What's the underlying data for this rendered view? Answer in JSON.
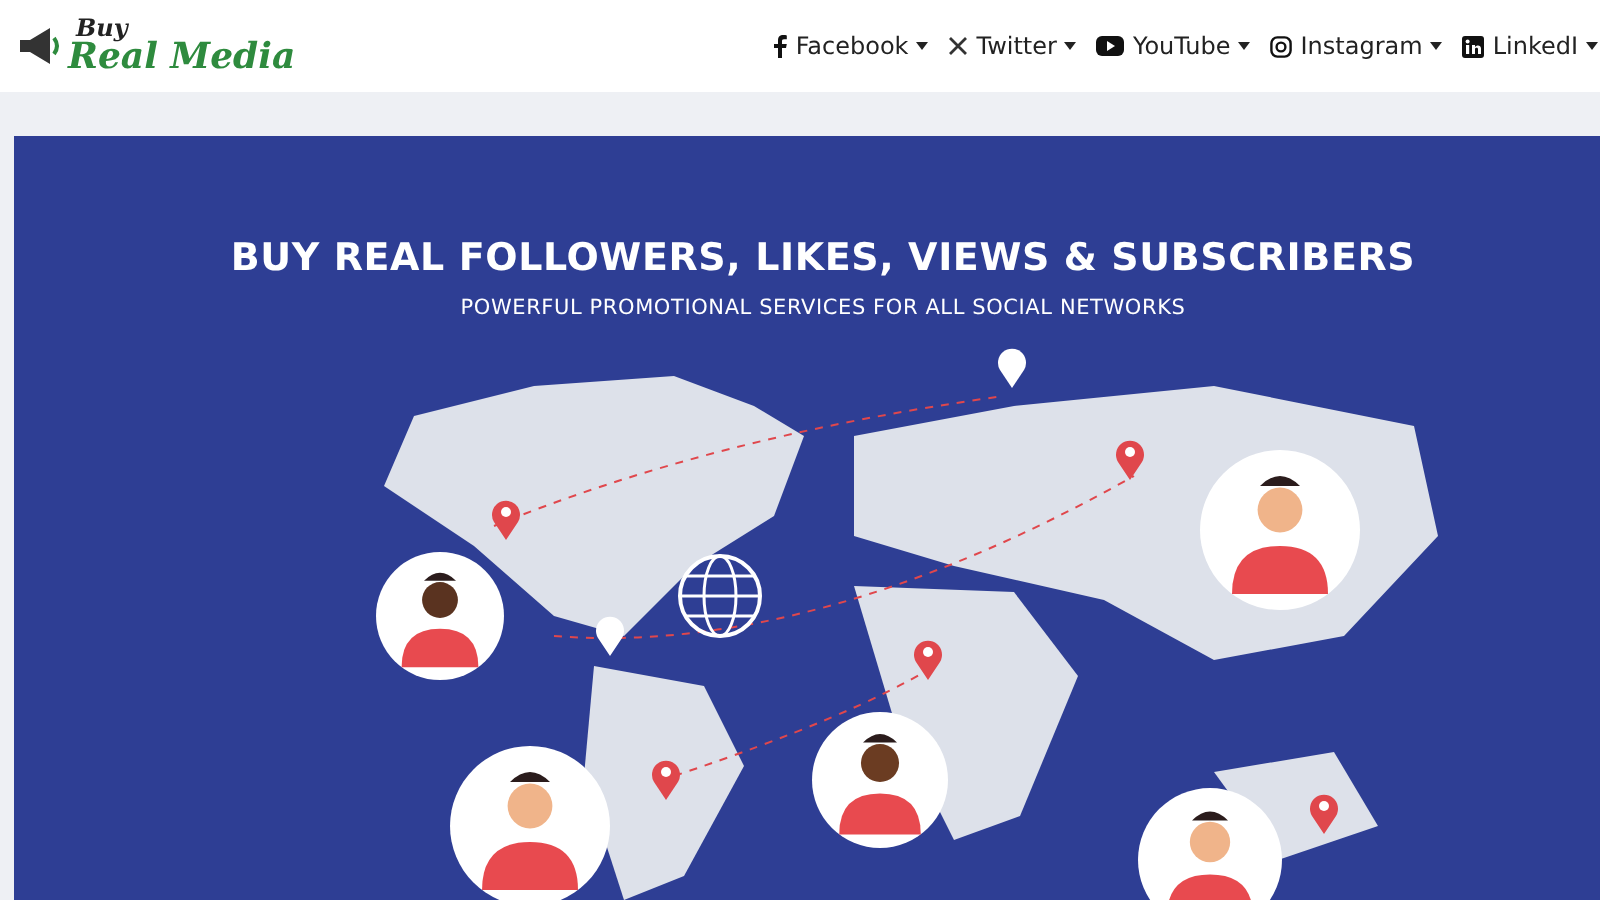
{
  "logo": {
    "top": "Buy",
    "bottom": "Real Media"
  },
  "nav": [
    {
      "label": "Facebook",
      "kind": "facebook"
    },
    {
      "label": "Twitter",
      "kind": "x"
    },
    {
      "label": "YouTube",
      "kind": "youtube"
    },
    {
      "label": "Instagram",
      "kind": "instagram"
    },
    {
      "label": "LinkedI",
      "kind": "linkedin"
    }
  ],
  "banner": {
    "title": "BUY REAL FOLLOWERS, LIKES, VIEWS & SUBSCRIBERS",
    "subtitle": "POWERFUL PROMOTIONAL SERVICES FOR ALL SOCIAL NETWORKS"
  }
}
